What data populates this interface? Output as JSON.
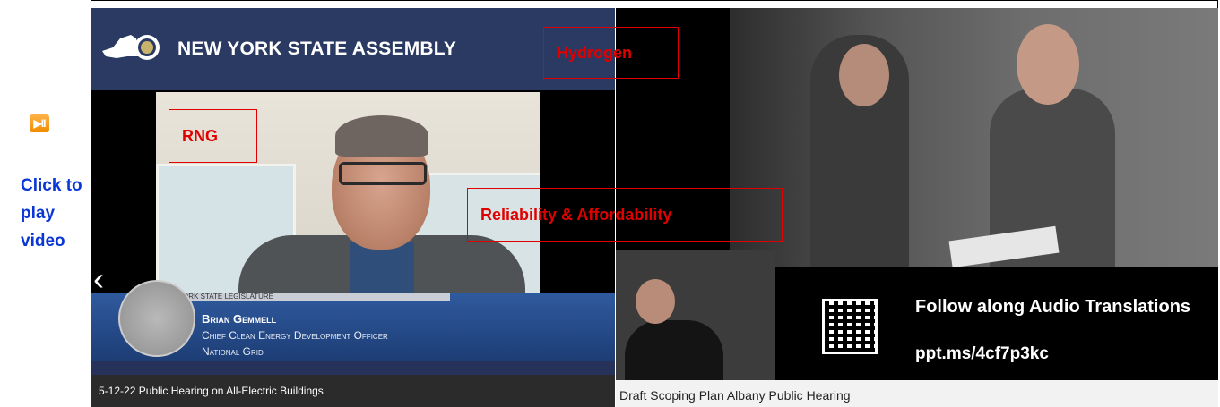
{
  "sidebar": {
    "play_icon_label": "▶II",
    "click_text": "Click to play video"
  },
  "left_video": {
    "header_title": "NEW YORK STATE ASSEMBLY",
    "legislature_bar": "NEW YORK STATE LEGISLATURE",
    "speaker_name": "Brian Gemmell",
    "speaker_title": "Chief Clean Energy Development Officer",
    "speaker_org": "National Grid",
    "caption": "5-12-22 Public Hearing on All-Electric Buildings",
    "nav_left": "‹"
  },
  "right_video": {
    "follow_text": "Follow along  Audio  Translations",
    "url_text": "ppt.ms/4cf7p3kc",
    "caption": "Draft Scoping Plan Albany Public Hearing"
  },
  "annotations": {
    "hydrogen": "Hydrogen",
    "rng": "RNG",
    "reliability": "Reliability & Affordability"
  },
  "colors": {
    "annotation": "#e00000",
    "link": "#0a36d6",
    "header": "#2b3a63"
  }
}
